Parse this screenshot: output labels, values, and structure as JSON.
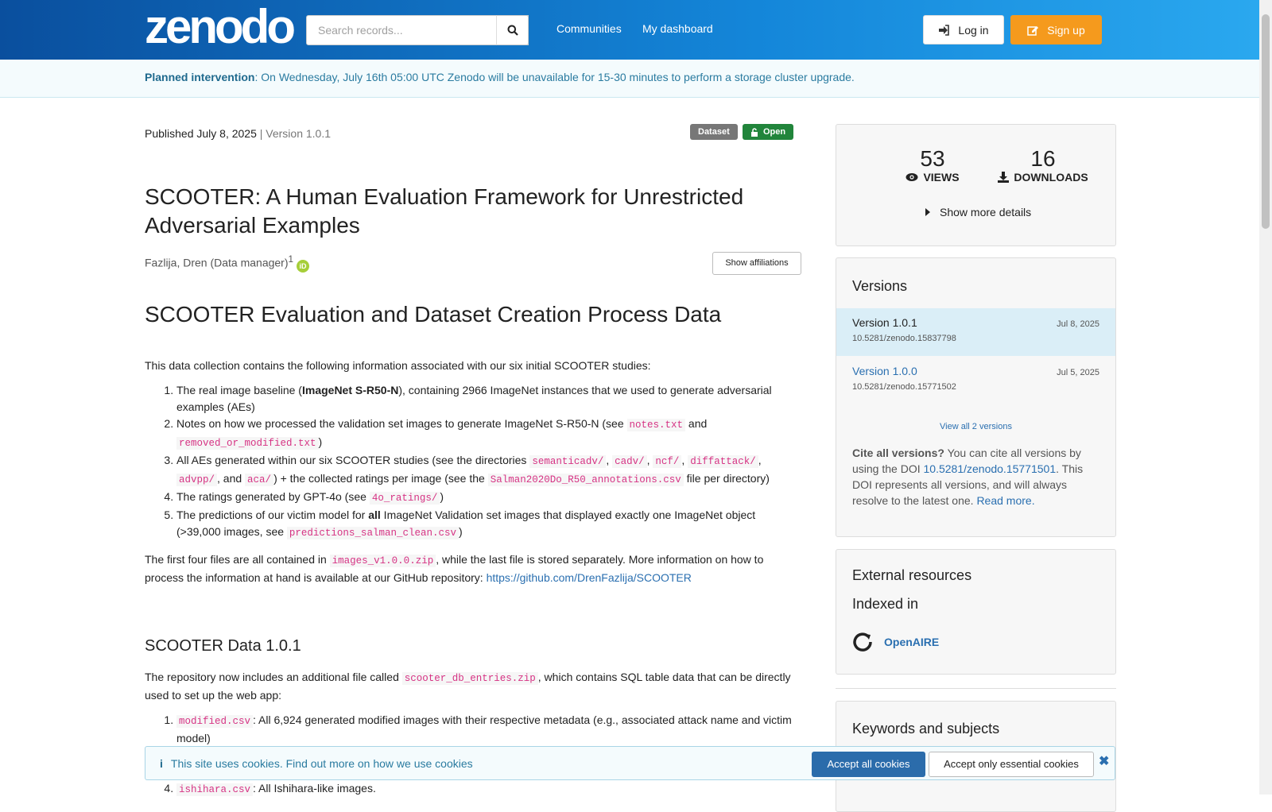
{
  "header": {
    "logo": "zenodo",
    "search_placeholder": "Search records...",
    "nav": [
      "Communities",
      "My dashboard"
    ],
    "login_label": "Log in",
    "signup_label": "Sign up",
    "brand_color": "#1486d9",
    "signup_color": "#f59a1d"
  },
  "banner": {
    "bold": "Planned intervention",
    "text": ": On Wednesday, July 16th 05:00 UTC Zenodo will be unavailable for 15-30 minutes to perform a storage cluster upgrade."
  },
  "record": {
    "published": "Published July 8, 2025",
    "version": "| Version 1.0.1",
    "badge_type": "Dataset",
    "badge_access": "Open",
    "title": "SCOOTER: A Human Evaluation Framework for Unrestricted Adversarial Examples",
    "author": "Fazlija, Dren (Data manager)",
    "author_sup": "1",
    "show_affiliations": "Show affiliations",
    "heading": "SCOOTER Evaluation and Dataset Creation Process Data",
    "intro": "This data collection contains the following information associated with our six initial SCOOTER studies:",
    "subheading": "SCOOTER Data 1.0.1",
    "github_link": "https://github.com/DrenFazlija/SCOOTER"
  },
  "stats": {
    "views": "53",
    "views_label": "VIEWS",
    "downloads": "16",
    "downloads_label": "DOWNLOADS",
    "more": "Show more details"
  },
  "versions": {
    "title": "Versions",
    "items": [
      {
        "label": "Version 1.0.1",
        "date": "Jul 8, 2025",
        "doi": "10.5281/zenodo.15837798"
      },
      {
        "label": "Version 1.0.0",
        "date": "Jul 5, 2025",
        "doi": "10.5281/zenodo.15771502"
      }
    ],
    "view_all": "View all 2 versions",
    "cite_bold": "Cite all versions?",
    "cite_text1": " You can cite all versions by using the DOI ",
    "cite_doi": "10.5281/zenodo.15771501",
    "cite_text2": ". This DOI represents all versions, and will always resolve to the latest one. ",
    "read_more": "Read more."
  },
  "external": {
    "title": "External resources",
    "indexed": "Indexed in",
    "openaire": "OpenAIRE"
  },
  "keywords_title": "Keywords and subjects",
  "cookie": {
    "text": "This site uses cookies. Find out more on ",
    "link": "how we use cookies",
    "accept_all": "Accept all cookies",
    "accept_essential": "Accept only essential cookies"
  }
}
